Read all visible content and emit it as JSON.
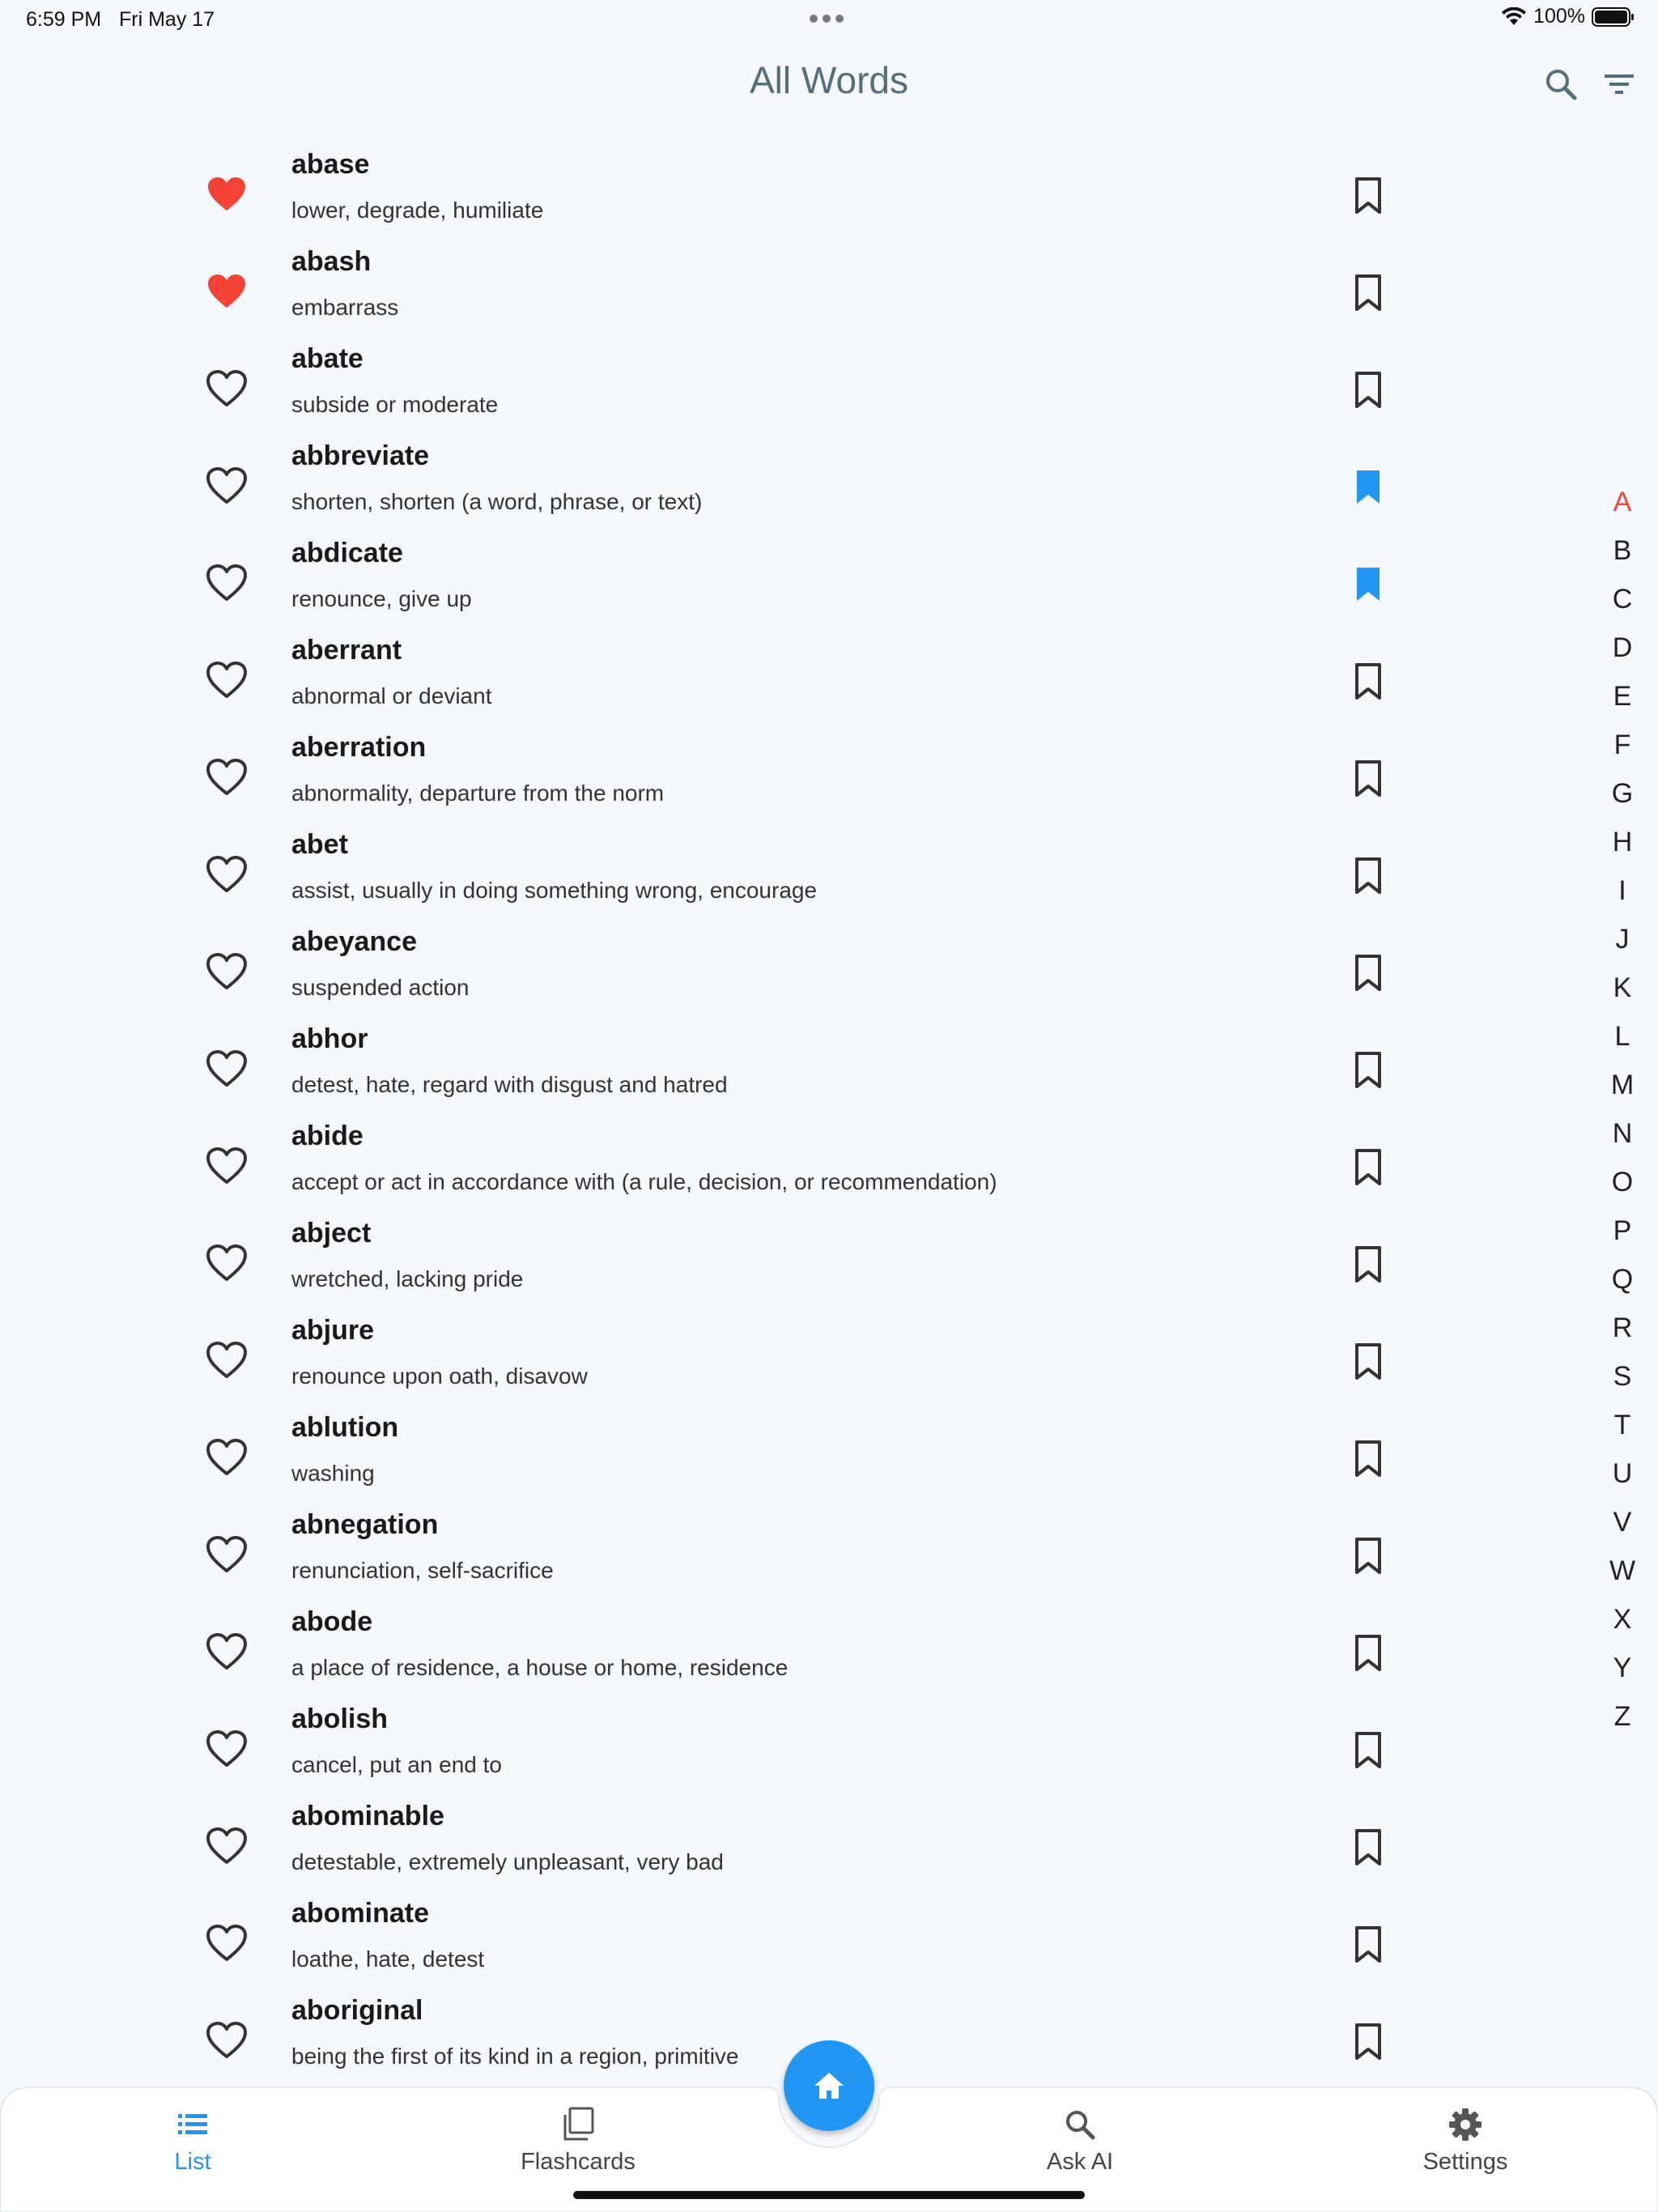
{
  "status": {
    "time": "6:59 PM",
    "date": "Fri May 17",
    "battery": "100%"
  },
  "header": {
    "title": "All Words"
  },
  "words": [
    {
      "word": "abase",
      "def": "lower, degrade, humiliate",
      "fav": true,
      "saved": false
    },
    {
      "word": "abash",
      "def": "embarrass",
      "fav": true,
      "saved": false
    },
    {
      "word": "abate",
      "def": "subside or moderate",
      "fav": false,
      "saved": false
    },
    {
      "word": "abbreviate",
      "def": "shorten, shorten (a word, phrase, or text)",
      "fav": false,
      "saved": true
    },
    {
      "word": "abdicate",
      "def": "renounce, give up",
      "fav": false,
      "saved": true
    },
    {
      "word": "aberrant",
      "def": "abnormal or deviant",
      "fav": false,
      "saved": false
    },
    {
      "word": "aberration",
      "def": "abnormality, departure from the norm",
      "fav": false,
      "saved": false
    },
    {
      "word": "abet",
      "def": "assist, usually in doing something wrong, encourage",
      "fav": false,
      "saved": false
    },
    {
      "word": "abeyance",
      "def": "suspended action",
      "fav": false,
      "saved": false
    },
    {
      "word": "abhor",
      "def": "detest, hate, regard with disgust and hatred",
      "fav": false,
      "saved": false
    },
    {
      "word": "abide",
      "def": "accept or act in accordance with (a rule, decision, or recommendation)",
      "fav": false,
      "saved": false
    },
    {
      "word": "abject",
      "def": "wretched, lacking pride",
      "fav": false,
      "saved": false
    },
    {
      "word": "abjure",
      "def": "renounce upon oath, disavow",
      "fav": false,
      "saved": false
    },
    {
      "word": "ablution",
      "def": "washing",
      "fav": false,
      "saved": false
    },
    {
      "word": "abnegation",
      "def": "renunciation, self-sacrifice",
      "fav": false,
      "saved": false
    },
    {
      "word": "abode",
      "def": "a place of residence, a house or home, residence",
      "fav": false,
      "saved": false
    },
    {
      "word": "abolish",
      "def": "cancel, put an end to",
      "fav": false,
      "saved": false
    },
    {
      "word": "abominable",
      "def": "detestable, extremely unpleasant, very bad",
      "fav": false,
      "saved": false
    },
    {
      "word": "abominate",
      "def": "loathe, hate, detest",
      "fav": false,
      "saved": false
    },
    {
      "word": "aboriginal",
      "def": "being the first of its kind in a region, primitive",
      "fav": false,
      "saved": false
    }
  ],
  "alphabet": [
    "A",
    "B",
    "C",
    "D",
    "E",
    "F",
    "G",
    "H",
    "I",
    "J",
    "K",
    "L",
    "M",
    "N",
    "O",
    "P",
    "Q",
    "R",
    "S",
    "T",
    "U",
    "V",
    "W",
    "X",
    "Y",
    "Z"
  ],
  "alphabet_active": "A",
  "nav": {
    "list": "List",
    "flashcards": "Flashcards",
    "ask_ai": "Ask AI",
    "settings": "Settings"
  },
  "colors": {
    "accent": "#2196f3",
    "favorite": "#f44336",
    "title": "#546e7a"
  },
  "icons": {
    "header": [
      "search-icon",
      "filter-icon"
    ],
    "row": [
      "heart-icon",
      "bookmark-icon"
    ],
    "nav": [
      "list-icon",
      "flashcards-icon",
      "home-icon",
      "search-icon",
      "gear-icon"
    ]
  }
}
